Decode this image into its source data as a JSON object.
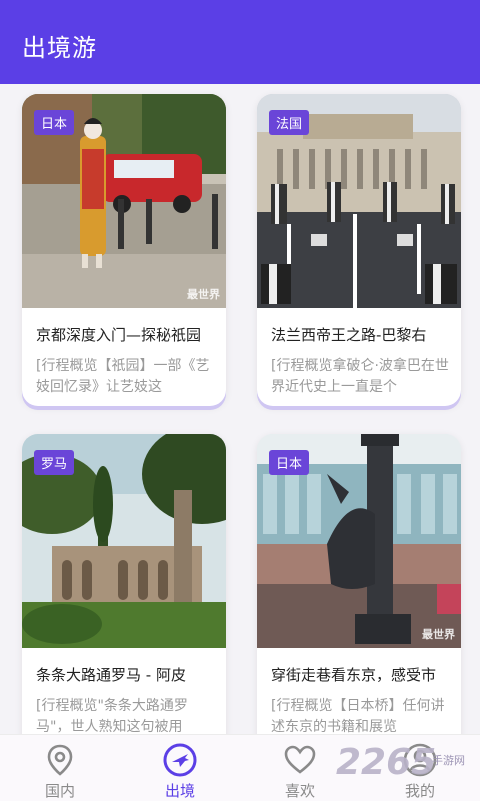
{
  "appbar": {
    "title": "出境游"
  },
  "cards": [
    {
      "tag": "日本",
      "title": "京都深度入门—探秘祇园",
      "desc": "[行程概览【祇园】一部《艺妓回忆录》让艺妓这",
      "watermark": "最世界"
    },
    {
      "tag": "法国",
      "title": "法兰西帝王之路-巴黎右",
      "desc": "[行程概览拿破仑·波拿巴在世界近代史上一直是个",
      "watermark": ""
    },
    {
      "tag": "罗马",
      "title": "条条大路通罗马 - 阿皮",
      "desc": "[行程概览\"条条大路通罗马\"，世人熟知这句被用",
      "watermark": ""
    },
    {
      "tag": "日本",
      "title": "穿街走巷看东京，感受市",
      "desc": "[行程概览【日本桥】任何讲述东京的书籍和展览",
      "watermark": "最世界"
    }
  ],
  "tabs": [
    {
      "label": "国内",
      "icon": "location-pin-icon",
      "active": false
    },
    {
      "label": "出境",
      "icon": "airplane-icon",
      "active": true
    },
    {
      "label": "喜欢",
      "icon": "heart-icon",
      "active": false
    },
    {
      "label": "我的",
      "icon": "user-icon",
      "active": false
    }
  ],
  "brand": {
    "number": "2265",
    "sub": "手游网"
  },
  "colors": {
    "accent": "#5b3fe6",
    "tag": "#6a45d8"
  }
}
